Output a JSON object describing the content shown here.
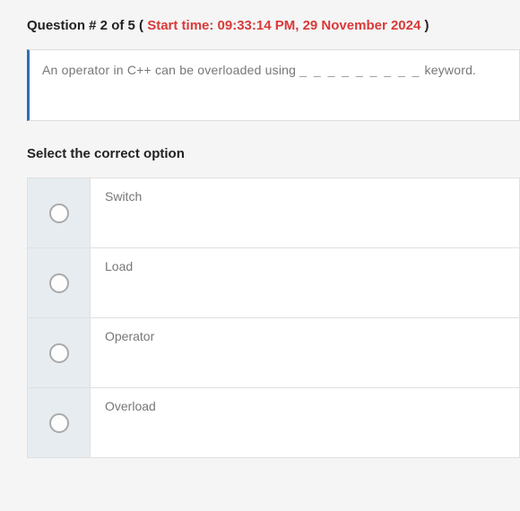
{
  "header": {
    "prefix": "Question # 2 of 5 ( ",
    "start_time": "Start time: 09:33:14 PM, 29 November 2024",
    "suffix": " )"
  },
  "question": {
    "text_before": "An operator in C++ can be overloaded using ",
    "blank": "_ _ _ _ _ _ _ _ _",
    "text_after": " keyword."
  },
  "select_label": "Select the correct option",
  "options": [
    {
      "label": "Switch"
    },
    {
      "label": "Load"
    },
    {
      "label": "Operator"
    },
    {
      "label": "Overload"
    }
  ]
}
